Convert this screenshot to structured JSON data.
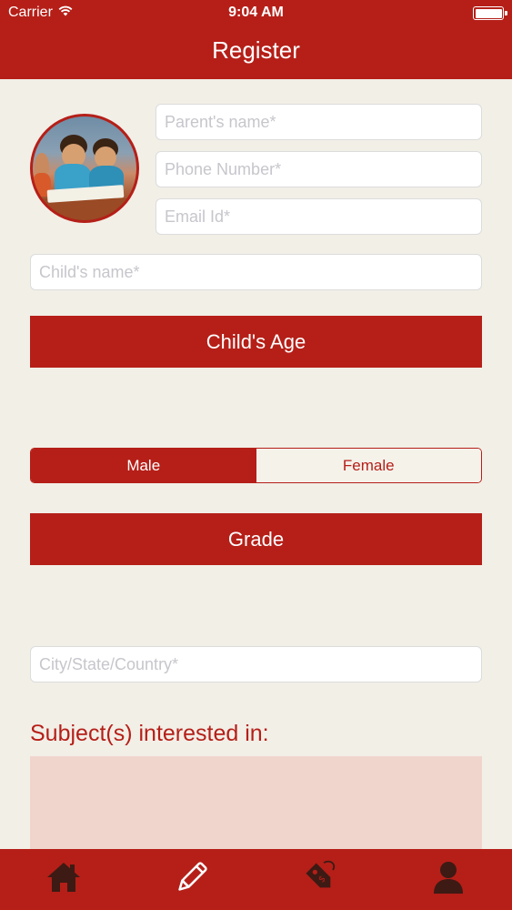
{
  "status_bar": {
    "carrier": "Carrier",
    "time": "9:04 AM"
  },
  "header": {
    "title": "Register"
  },
  "form": {
    "parent_name_placeholder": "Parent's name*",
    "phone_placeholder": "Phone Number*",
    "email_placeholder": "Email Id*",
    "child_name_placeholder": "Child's name*",
    "child_age_label": "Child's Age",
    "gender": {
      "options": [
        "Male",
        "Female"
      ],
      "selected": "Male"
    },
    "grade_label": "Grade",
    "location_placeholder": "City/State/Country*",
    "subjects_heading": "Subject(s) interested in:"
  },
  "tab_bar": {
    "items": [
      {
        "icon": "home-icon"
      },
      {
        "icon": "pencil-icon"
      },
      {
        "icon": "price-tag-icon"
      },
      {
        "icon": "user-icon"
      }
    ]
  },
  "colors": {
    "primary": "#b51f18",
    "background": "#f2efe7",
    "subjects_area": "#f0d5cc"
  }
}
